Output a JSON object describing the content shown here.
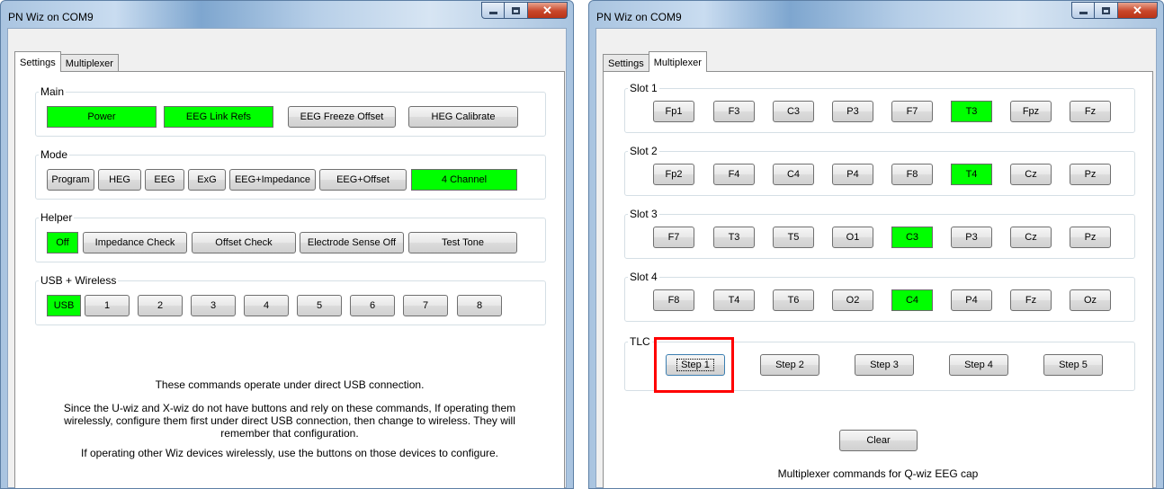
{
  "left_window": {
    "title": "PN Wiz on COM9",
    "tabs": [
      {
        "label": "Settings",
        "active": true
      },
      {
        "label": "Multiplexer",
        "active": false
      }
    ],
    "groups": {
      "main": {
        "label": "Main",
        "buttons": [
          {
            "label": "Power",
            "on": true
          },
          {
            "label": "EEG Link Refs",
            "on": true
          },
          {
            "label": "EEG Freeze Offset",
            "on": false
          },
          {
            "label": "HEG Calibrate",
            "on": false
          }
        ]
      },
      "mode": {
        "label": "Mode",
        "buttons": [
          {
            "label": "Program",
            "on": false
          },
          {
            "label": "HEG",
            "on": false
          },
          {
            "label": "EEG",
            "on": false
          },
          {
            "label": "ExG",
            "on": false
          },
          {
            "label": "EEG+Impedance",
            "on": false
          },
          {
            "label": "EEG+Offset",
            "on": false
          },
          {
            "label": "4 Channel",
            "on": true
          }
        ]
      },
      "helper": {
        "label": "Helper",
        "buttons": [
          {
            "label": "Off",
            "on": true
          },
          {
            "label": "Impedance Check",
            "on": false
          },
          {
            "label": "Offset Check",
            "on": false
          },
          {
            "label": "Electrode Sense Off",
            "on": false
          },
          {
            "label": "Test Tone",
            "on": false
          }
        ]
      },
      "usb": {
        "label": "USB + Wireless",
        "buttons": [
          {
            "label": "USB",
            "on": true
          },
          {
            "label": "1",
            "on": false
          },
          {
            "label": "2",
            "on": false
          },
          {
            "label": "3",
            "on": false
          },
          {
            "label": "4",
            "on": false
          },
          {
            "label": "5",
            "on": false
          },
          {
            "label": "6",
            "on": false
          },
          {
            "label": "7",
            "on": false
          },
          {
            "label": "8",
            "on": false
          }
        ]
      }
    },
    "info_lines": [
      "These commands operate under direct USB connection.",
      "Since the U-wiz and X-wiz do not have buttons and rely on these commands, If operating them",
      "wirelessly, configure them first under direct USB connection, then change to wireless. They will",
      "remember that configuration.",
      "If operating other Wiz devices wirelessly, use the buttons on those devices to configure."
    ]
  },
  "right_window": {
    "title": "PN Wiz on COM9",
    "tabs": [
      {
        "label": "Settings",
        "active": false
      },
      {
        "label": "Multiplexer",
        "active": true
      }
    ],
    "slots": [
      {
        "label": "Slot 1",
        "buttons": [
          {
            "label": "Fp1",
            "on": false
          },
          {
            "label": "F3",
            "on": false
          },
          {
            "label": "C3",
            "on": false
          },
          {
            "label": "P3",
            "on": false
          },
          {
            "label": "F7",
            "on": false
          },
          {
            "label": "T3",
            "on": true
          },
          {
            "label": "Fpz",
            "on": false
          },
          {
            "label": "Fz",
            "on": false
          }
        ]
      },
      {
        "label": "Slot 2",
        "buttons": [
          {
            "label": "Fp2",
            "on": false
          },
          {
            "label": "F4",
            "on": false
          },
          {
            "label": "C4",
            "on": false
          },
          {
            "label": "P4",
            "on": false
          },
          {
            "label": "F8",
            "on": false
          },
          {
            "label": "T4",
            "on": true
          },
          {
            "label": "Cz",
            "on": false
          },
          {
            "label": "Pz",
            "on": false
          }
        ]
      },
      {
        "label": "Slot 3",
        "buttons": [
          {
            "label": "F7",
            "on": false
          },
          {
            "label": "T3",
            "on": false
          },
          {
            "label": "T5",
            "on": false
          },
          {
            "label": "O1",
            "on": false
          },
          {
            "label": "C3",
            "on": true
          },
          {
            "label": "P3",
            "on": false
          },
          {
            "label": "Cz",
            "on": false
          },
          {
            "label": "Pz",
            "on": false
          }
        ]
      },
      {
        "label": "Slot 4",
        "buttons": [
          {
            "label": "F8",
            "on": false
          },
          {
            "label": "T4",
            "on": false
          },
          {
            "label": "T6",
            "on": false
          },
          {
            "label": "O2",
            "on": false
          },
          {
            "label": "C4",
            "on": true
          },
          {
            "label": "P4",
            "on": false
          },
          {
            "label": "Fz",
            "on": false
          },
          {
            "label": "Oz",
            "on": false
          }
        ]
      }
    ],
    "tlc": {
      "label": "TLC",
      "buttons": [
        {
          "label": "Step 1",
          "focused": true
        },
        {
          "label": "Step 2",
          "focused": false
        },
        {
          "label": "Step 3",
          "focused": false
        },
        {
          "label": "Step 4",
          "focused": false
        },
        {
          "label": "Step 5",
          "focused": false
        }
      ]
    },
    "clear_label": "Clear",
    "footer_text": "Multiplexer commands for Q-wiz EEG cap"
  },
  "colors": {
    "active_button": "#00ff00",
    "highlight_box": "#ff0000"
  }
}
